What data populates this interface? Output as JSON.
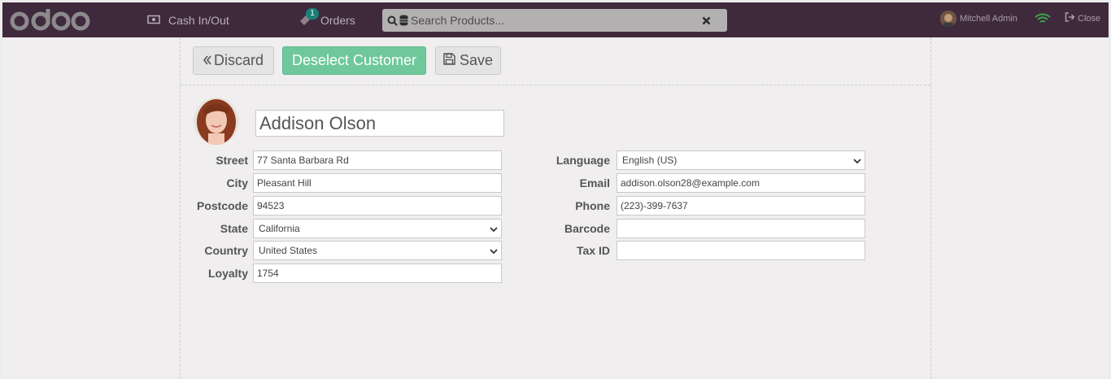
{
  "topbar": {
    "logo_text": "odoo",
    "cash_label": "Cash In/Out",
    "orders_label": "Orders",
    "orders_badge": "1",
    "search_placeholder": "Search Products...",
    "user_name": "Mitchell Admin",
    "close_label": "Close"
  },
  "actions": {
    "discard_label": "Discard",
    "deselect_label": "Deselect Customer",
    "save_label": "Save"
  },
  "customer": {
    "name": "Addison Olson",
    "left_fields": [
      {
        "label": "Street",
        "value": "77 Santa Barbara Rd"
      },
      {
        "label": "City",
        "value": "Pleasant Hill"
      },
      {
        "label": "Postcode",
        "value": "94523"
      },
      {
        "label": "State",
        "value": "California"
      },
      {
        "label": "Country",
        "value": "United States"
      },
      {
        "label": "Loyalty",
        "value": "1754"
      }
    ],
    "right_fields": [
      {
        "label": "Language",
        "value": "English (US)"
      },
      {
        "label": "Email",
        "value": "addison.olson28@example.com"
      },
      {
        "label": "Phone",
        "value": "(223)-399-7637"
      },
      {
        "label": "Barcode",
        "value": ""
      },
      {
        "label": "Tax ID",
        "value": ""
      }
    ]
  },
  "colors": {
    "topbar": "#3f2a3d",
    "accent_green": "#6ec89b",
    "wifi_green": "#3fa34d"
  }
}
